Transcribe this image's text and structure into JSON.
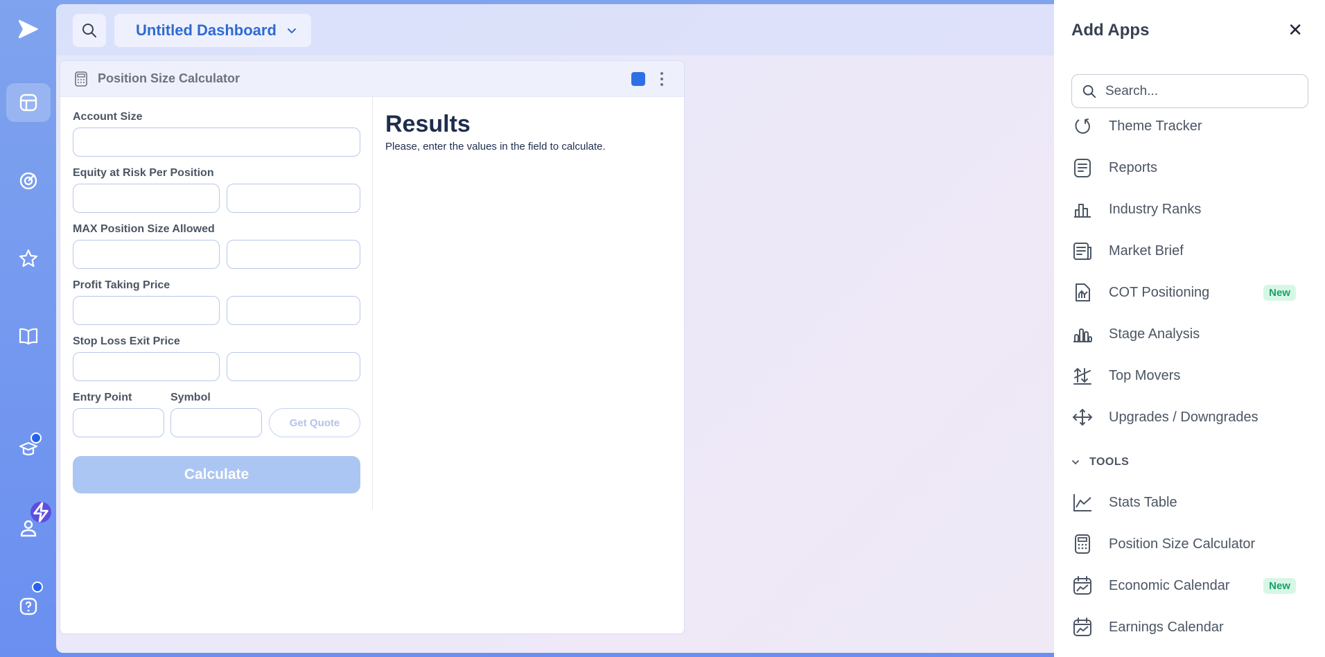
{
  "topbar": {
    "dashboard_name": "Untitled Dashboard"
  },
  "widget": {
    "title": "Position Size Calculator",
    "accent_color": "#2f6fe6",
    "labels": {
      "account_size": "Account Size",
      "equity_at_risk": "Equity at Risk Per Position",
      "max_position": "MAX Position Size Allowed",
      "profit_taking": "Profit Taking Price",
      "stop_loss": "Stop Loss Exit Price",
      "entry_point": "Entry Point",
      "symbol": "Symbol"
    },
    "get_quote": "Get Quote",
    "calculate": "Calculate",
    "results_title": "Results",
    "results_msg": "Please, enter the values in the field to calculate."
  },
  "panel": {
    "title": "Add Apps",
    "search_placeholder": "Search...",
    "items": [
      {
        "label": "Theme Tracker",
        "icon": "refresh-icon"
      },
      {
        "label": "Reports",
        "icon": "document-icon"
      },
      {
        "label": "Industry Ranks",
        "icon": "bar-chart-icon"
      },
      {
        "label": "Market Brief",
        "icon": "newspaper-icon"
      },
      {
        "label": "COT Positioning",
        "icon": "report-chart-icon",
        "badge": "New"
      },
      {
        "label": "Stage Analysis",
        "icon": "stage-chart-icon"
      },
      {
        "label": "Top Movers",
        "icon": "movers-icon"
      },
      {
        "label": "Upgrades / Downgrades",
        "icon": "arrows-icon"
      }
    ],
    "section_label": "TOOLS",
    "tools": [
      {
        "label": "Stats Table",
        "icon": "line-chart-icon"
      },
      {
        "label": "Position Size Calculator",
        "icon": "calculator-icon"
      },
      {
        "label": "Economic Calendar",
        "icon": "calendar-chart-icon",
        "badge": "New"
      },
      {
        "label": "Earnings Calendar",
        "icon": "calendar-chart-icon"
      }
    ]
  }
}
